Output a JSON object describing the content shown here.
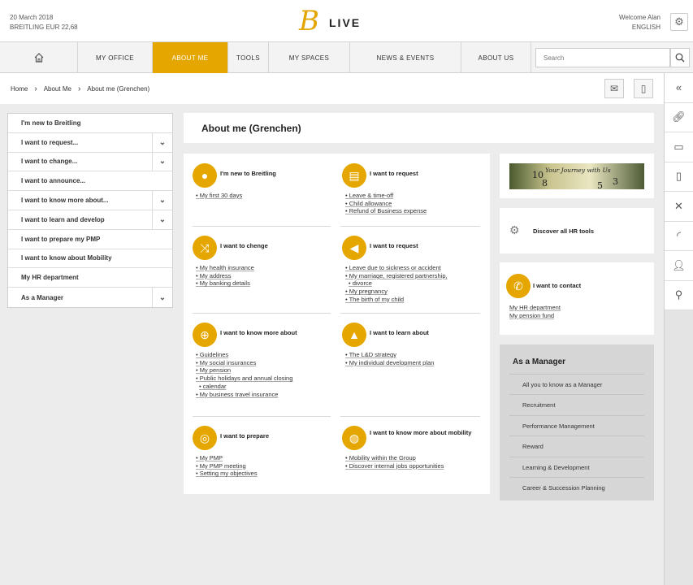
{
  "header": {
    "date": "20 March 2018",
    "stock": "BREITLING EUR 22,68",
    "logo_b": "B",
    "logo_text": "LIVE",
    "welcome": "Welcome Alan",
    "language": "ENGLISH"
  },
  "nav": {
    "items": [
      "MY OFFICE",
      "ABOUT ME",
      "TOOLS",
      "MY SPACES",
      "NEWS & EVENTS",
      "ABOUT US"
    ],
    "search_placeholder": "Search"
  },
  "breadcrumb": [
    "Home",
    "About Me",
    "About me (Grenchen)"
  ],
  "left_menu": [
    "I'm new to Breitling",
    "I want to request...",
    "I want to change...",
    "I want to announce...",
    "I want to know more about...",
    "I want to learn and develop",
    "I want to prepare my PMP",
    "I want to know about Mobility",
    "My HR department",
    "As a Manager"
  ],
  "page_title": "About me (Grenchen)",
  "cards": [
    {
      "title": "I'm new to Breitling",
      "links": [
        "My first 30 days"
      ]
    },
    {
      "title": "I want to request",
      "links": [
        "Leave & time-off",
        "Child allowance",
        "Refund of Business expense"
      ]
    },
    {
      "title": "I want to chenge",
      "links": [
        "My health insurance",
        "My address",
        "My banking details"
      ]
    },
    {
      "title": "I want to request",
      "links": [
        "Leave due to sickness or accident",
        "My marriage, registered partnership,",
        "divorce",
        "My pregnancy",
        "The birth of my child"
      ]
    },
    {
      "title": "I want to know more about",
      "links": [
        "Guidelines",
        "My social insurances",
        "My pension",
        "Public holidays and annual closing",
        "calendar",
        "My business travel insurance"
      ]
    },
    {
      "title": "I want to learn about",
      "links": [
        "The L&D strategy",
        "My individual development plan"
      ]
    },
    {
      "title": "I want to prepare",
      "links": [
        "My PMP",
        "My PMP meeting",
        "Setting my objectives"
      ]
    },
    {
      "title": "I want to know more about mobility",
      "links": [
        "Mobility within the Group",
        "Discover internal jobs opportunities"
      ]
    }
  ],
  "banner": {
    "text": "Your Journey with Us",
    "num1": "10",
    "num2": "3",
    "num3": "8",
    "num4": "5"
  },
  "hr_tools": "Discover all HR tools",
  "contact": {
    "title": "I want to contact",
    "links": [
      "My HR department",
      "My pension fund"
    ]
  },
  "manager": {
    "title": "As a Manager",
    "items": [
      "All you to know as a Manager",
      "Recruitment",
      "Performance Management",
      "Reward",
      "Learning & Development",
      "Career & Succession Planning"
    ]
  }
}
